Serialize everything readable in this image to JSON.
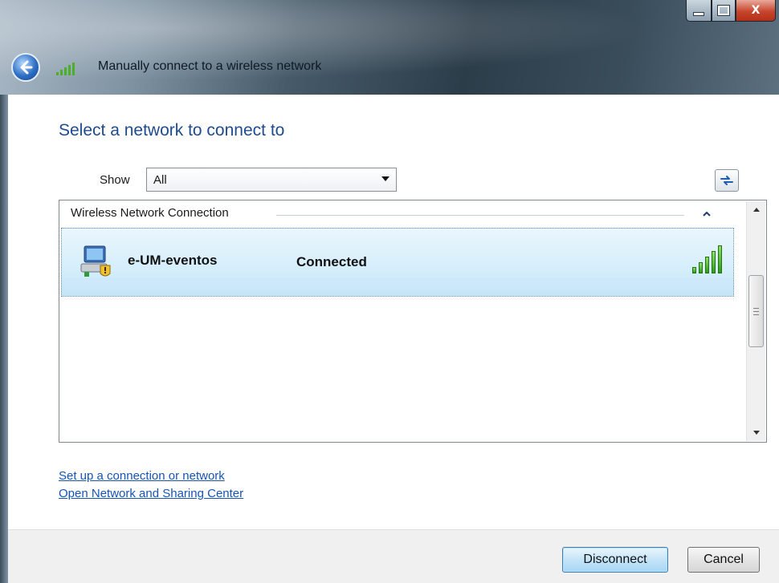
{
  "window": {
    "title": "Manually connect to a wireless network",
    "caption_close": "X"
  },
  "page": {
    "heading": "Select a network to connect to",
    "show_label": "Show",
    "show_value": "All"
  },
  "list": {
    "group_header": "Wireless Network Connection",
    "networks": [
      {
        "name": "e-UM-eventos",
        "status": "Connected",
        "signal_bars": 5
      }
    ]
  },
  "links": {
    "setup": "Set up a connection or network",
    "sharing_center": "Open Network and Sharing Center"
  },
  "buttons": {
    "disconnect": "Disconnect",
    "cancel": "Cancel"
  },
  "colors": {
    "heading": "#1f4b8f",
    "link": "#1654b3",
    "signal": "#2e9b18",
    "selection": "#c4e5f8"
  }
}
